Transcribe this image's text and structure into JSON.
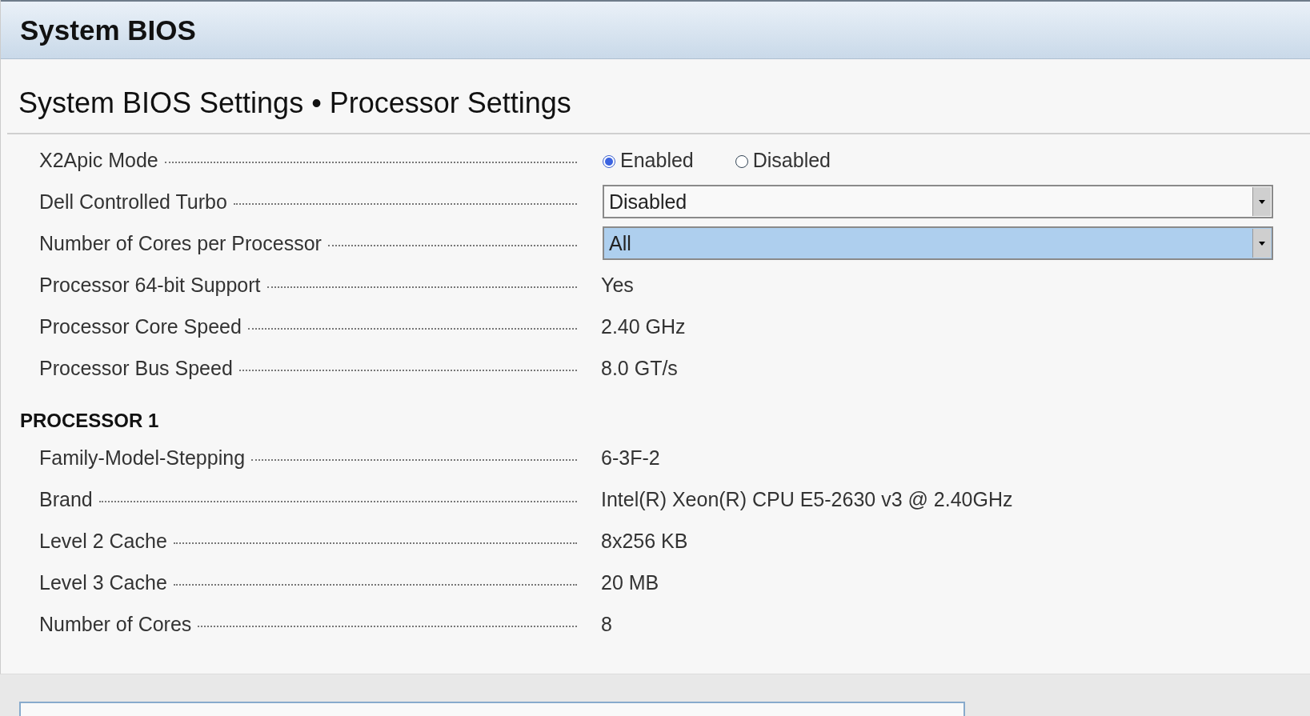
{
  "header": {
    "title": "System BIOS"
  },
  "page_title": "System BIOS Settings • Processor Settings",
  "rows": [
    {
      "kind": "radio",
      "label": "X2Apic Mode",
      "options": [
        {
          "label": "Enabled",
          "selected": true
        },
        {
          "label": "Disabled",
          "selected": false
        }
      ]
    },
    {
      "kind": "select",
      "label": "Dell Controlled Turbo",
      "value": "Disabled",
      "focused": false
    },
    {
      "kind": "select",
      "label": "Number of Cores per Processor",
      "value": "All",
      "focused": true
    },
    {
      "kind": "value",
      "label": "Processor 64-bit Support",
      "value": "Yes"
    },
    {
      "kind": "value",
      "label": "Processor Core Speed",
      "value": "2.40 GHz"
    },
    {
      "kind": "value",
      "label": "Processor Bus Speed",
      "value": "8.0 GT/s"
    },
    {
      "kind": "heading",
      "label": "PROCESSOR 1"
    },
    {
      "kind": "value",
      "label": "Family-Model-Stepping",
      "value": "6-3F-2"
    },
    {
      "kind": "value",
      "label": "Brand",
      "value": "Intel(R) Xeon(R) CPU E5-2630 v3 @ 2.40GHz"
    },
    {
      "kind": "value",
      "label": "Level 2 Cache",
      "value": "8x256 KB"
    },
    {
      "kind": "value",
      "label": "Level 3 Cache",
      "value": "20 MB"
    },
    {
      "kind": "value",
      "label": "Number of Cores",
      "value": "8"
    }
  ]
}
